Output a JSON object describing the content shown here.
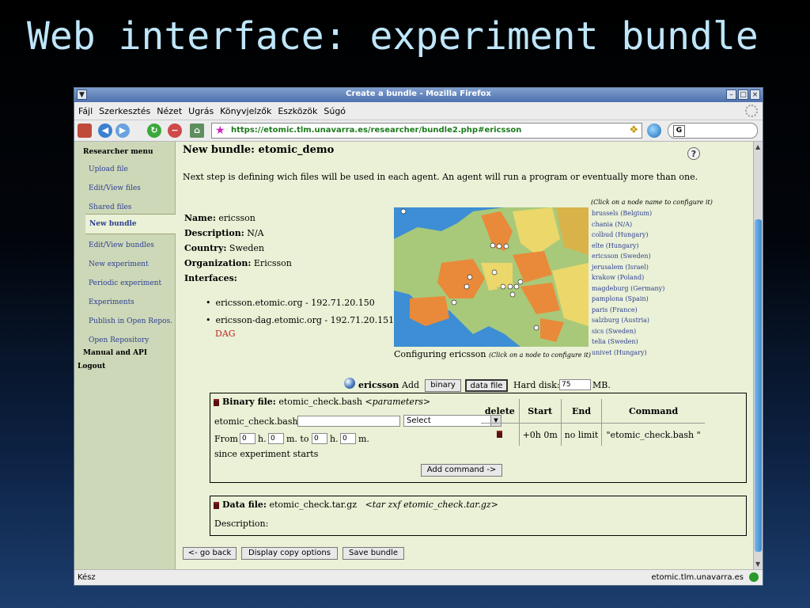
{
  "slide_title": "Web interface: experiment bundle",
  "window": {
    "title": "Create a bundle - Mozilla Firefox",
    "menu": [
      "Fájl",
      "Szerkesztés",
      "Nézet",
      "Ugrás",
      "Könyvjelzők",
      "Eszközök",
      "Súgó"
    ],
    "url": "https://etomic.tlm.unavarra.es/researcher/bundle2.php#ericsson",
    "search_placeholder": "",
    "status_left": "Kész",
    "status_right": "etomic.tlm.unavarra.es"
  },
  "sidebar": {
    "heading": "Researcher menu",
    "items": [
      "Upload file",
      "Edit/View files",
      "Shared files",
      "New bundle",
      "Edit/View bundles",
      "New experiment",
      "Periodic experiment",
      "Experiments",
      "Publish in Open Repos.",
      "Open Repository"
    ],
    "selected": "New bundle",
    "manual": "Manual and API",
    "logout": "Logout"
  },
  "main": {
    "title": "New bundle: etomic_demo",
    "help": "?",
    "intro": "Next step is defining wich files will be used in each agent. An agent will run a program or eventually more than one.",
    "name_label": "Name:",
    "name_value": "ericsson",
    "description_label": "Description:",
    "description_value": "N/A",
    "country_label": "Country:",
    "country_value": "Sweden",
    "organization_label": "Organization:",
    "organization_value": "Ericsson",
    "interfaces_label": "Interfaces:",
    "interfaces": [
      "ericsson.etomic.org - 192.71.20.150",
      "ericsson-dag.etomic.org - 192.71.20.151"
    ],
    "dag": "DAG",
    "map_caption": "Configuring ericsson",
    "map_caption_hint": "(Click on a node to configure it)",
    "nodes_hint": "(Click on a node name to configure it)",
    "nodes": [
      "brussels (Belgium)",
      "chania (N/A)",
      "colbud (Hungary)",
      "elte (Hungary)",
      "ericsson (Sweden)",
      "jerusalem (Israel)",
      "krakow (Poland)",
      "magdeburg (Germany)",
      "pamplona (Spain)",
      "paris (France)",
      "salzburg (Austria)",
      "sics (Sweden)",
      "telia (Sweden)",
      "univet (Hungary)"
    ]
  },
  "agent": {
    "name": "ericsson",
    "add_label": "Add",
    "binary_button": "binary",
    "data_file_button": "data file",
    "hard_disk_label": "Hard disk:",
    "hard_disk_value": "75",
    "hard_disk_unit": "MB."
  },
  "binary_file": {
    "label": "Binary file:",
    "filename": "etomic_check.bash",
    "params": "<parameters>",
    "param_label": "etomic_check.bash",
    "param_value": "",
    "select_value": "Select",
    "from_label": "From",
    "from_h": "0",
    "h1": "h.",
    "from_m": "0",
    "m1": "m. to",
    "to_h": "0",
    "h2": "h.",
    "to_m": "0",
    "m2": "m.",
    "since": "since experiment starts",
    "add_command_button": "Add command ->",
    "table_headers": [
      "delete",
      "Start",
      "End",
      "Command"
    ],
    "row": {
      "start": "+0h 0m",
      "end": "no limit",
      "command": "\"etomic_check.bash \""
    }
  },
  "data_file": {
    "label": "Data file:",
    "filename": "etomic_check.tar.gz",
    "cmd": "<tar zxf etomic_check.tar.gz>",
    "description_label": "Description:"
  },
  "footer_buttons": {
    "back": "<- go back",
    "copy": "Display copy options",
    "save": "Save bundle"
  },
  "colors": {
    "slide_title": "#bfe6fb",
    "page_background": "#eaf1d6",
    "sidebar_background": "#cdd8b8",
    "link": "#2e3f92",
    "dag": "#c0231d",
    "map_sea": "#3d8ed4",
    "map_orange": "#e98a3a",
    "map_yellow": "#ecd76a",
    "map_green": "#a9c97a"
  }
}
